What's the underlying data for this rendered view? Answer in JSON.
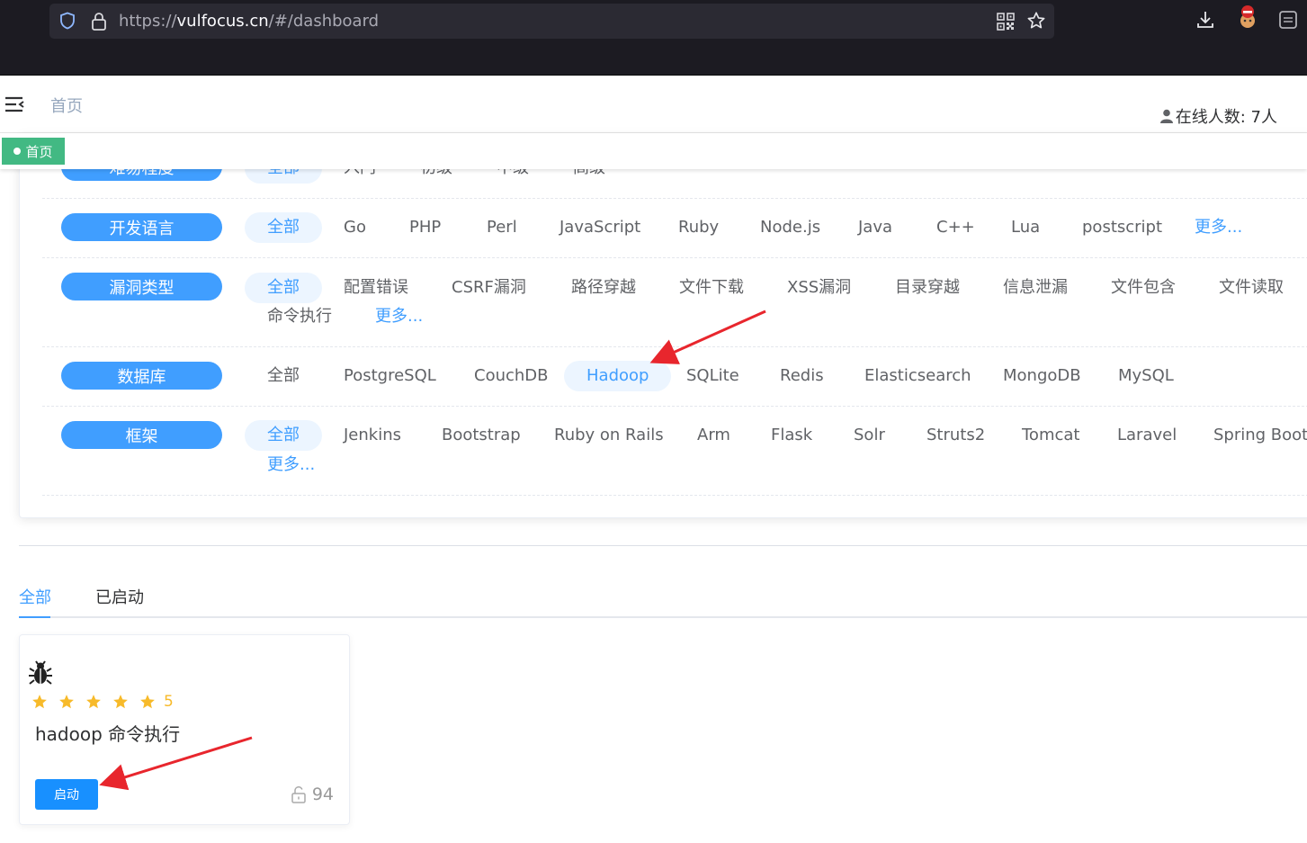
{
  "browser": {
    "url_prefix": "https://",
    "url_host": "vulfocus.cn",
    "url_path": "/#/dashboard",
    "icons": [
      "shield-icon",
      "lock-icon",
      "qr-code-icon",
      "star-icon",
      "download-icon",
      "extension-icon",
      "menu-icon"
    ]
  },
  "header": {
    "breadcrumb": "首页",
    "online_users": "在线人数: 7人"
  },
  "tags": {
    "home": "首页"
  },
  "filters": {
    "difficulty": {
      "label": "难易程度",
      "options": [
        "全部",
        "入门",
        "初级",
        "中级",
        "高级"
      ]
    },
    "language": {
      "label": "开发语言",
      "options": [
        "全部",
        "Go",
        "PHP",
        "Perl",
        "JavaScript",
        "Ruby",
        "Node.js",
        "Java",
        "C++",
        "Lua",
        "postscript"
      ],
      "more": "更多..."
    },
    "vuln_type": {
      "label": "漏洞类型",
      "options": [
        "全部",
        "配置错误",
        "CSRF漏洞",
        "路径穿越",
        "文件下载",
        "XSS漏洞",
        "目录穿越",
        "信息泄漏",
        "文件包含",
        "文件读取",
        "命令执行"
      ],
      "more": "更多..."
    },
    "database": {
      "label": "数据库",
      "options": [
        "全部",
        "PostgreSQL",
        "CouchDB",
        "Hadoop",
        "SQLite",
        "Redis",
        "Elasticsearch",
        "MongoDB",
        "MySQL"
      ],
      "selected": "Hadoop"
    },
    "framework": {
      "label": "框架",
      "options": [
        "全部",
        "Jenkins",
        "Bootstrap",
        "Ruby on Rails",
        "Arm",
        "Flask",
        "Solr",
        "Struts2",
        "Tomcat",
        "Laravel",
        "Spring Boot"
      ],
      "more": "更多..."
    }
  },
  "tabs": [
    "全部",
    "已启动"
  ],
  "active_tab": "全部",
  "vuln_card": {
    "rating": 5,
    "rating_label": "5",
    "title": "hadoop 命令执行",
    "start_label": "启动",
    "downloads": "94"
  },
  "colors": {
    "primary": "#409eff",
    "tag_green": "#42b983",
    "star": "#f7ba2a",
    "arrow": "#e8262d"
  }
}
